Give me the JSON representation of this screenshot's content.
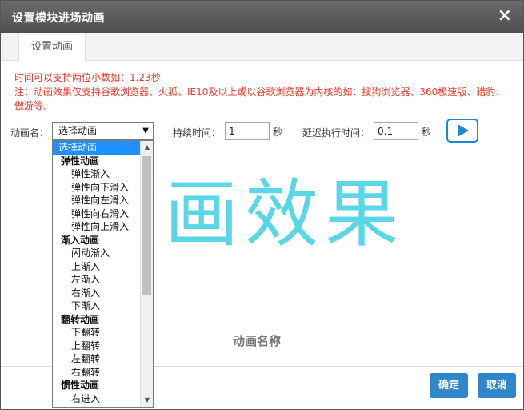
{
  "dialog": {
    "title": "设置模块进场动画",
    "close_icon": "×"
  },
  "tabs": [
    {
      "label": "设置动画"
    }
  ],
  "notes": {
    "line1": "时间可以支持两位小数如：1.23秒",
    "line2": "注：动画效果仅支持谷歌浏览器、火狐、IE10及以上或以谷歌浏览器为内核的如：搜狗浏览器、360极速版、猎豹、傲游等。"
  },
  "controls": {
    "anim_label": "动画名：",
    "anim_selected": "选择动画",
    "duration_label": "持续时间：",
    "duration_value": "1",
    "duration_unit": "秒",
    "delay_label": "延迟执行时间：",
    "delay_value": "0.1",
    "delay_unit": "秒",
    "play_icon": "play-icon"
  },
  "preview": {
    "glyphs": "画效果",
    "anim_name": "动画名称"
  },
  "dropdown": {
    "items": [
      {
        "type": "selected",
        "label": "选择动画"
      },
      {
        "type": "group",
        "label": "弹性动画"
      },
      {
        "type": "opt",
        "label": "弹性渐入"
      },
      {
        "type": "opt",
        "label": "弹性向下滑入"
      },
      {
        "type": "opt",
        "label": "弹性向左滑入"
      },
      {
        "type": "opt",
        "label": "弹性向右滑入"
      },
      {
        "type": "opt",
        "label": "弹性向上滑入"
      },
      {
        "type": "group",
        "label": "渐入动画"
      },
      {
        "type": "opt",
        "label": "闪动渐入"
      },
      {
        "type": "opt",
        "label": "上渐入"
      },
      {
        "type": "opt",
        "label": "左渐入"
      },
      {
        "type": "opt",
        "label": "右渐入"
      },
      {
        "type": "opt",
        "label": "下渐入"
      },
      {
        "type": "group",
        "label": "翻转动画"
      },
      {
        "type": "opt",
        "label": "下翻转"
      },
      {
        "type": "opt",
        "label": "上翻转"
      },
      {
        "type": "opt",
        "label": "左翻转"
      },
      {
        "type": "opt",
        "label": "右翻转"
      },
      {
        "type": "group",
        "label": "惯性动画"
      },
      {
        "type": "opt",
        "label": "右进入"
      }
    ]
  },
  "footer": {
    "ok_label": "确定",
    "cancel_label": "取消"
  },
  "colors": {
    "accent": "#2f87c9",
    "note": "#e63c2e",
    "preview_glyph": "#5ad6e6",
    "selected_item": "#1e90ff"
  }
}
